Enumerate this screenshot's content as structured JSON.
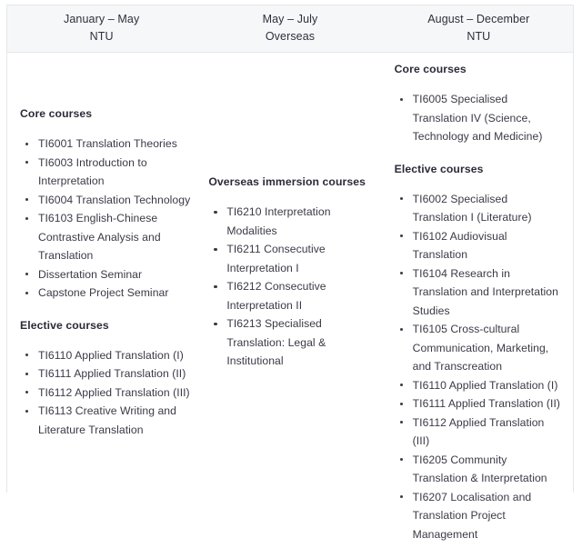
{
  "table": {
    "headers": [
      {
        "period": "January – May",
        "location": "NTU"
      },
      {
        "period": "May – July",
        "location": "Overseas"
      },
      {
        "period": "August – December",
        "location": "NTU"
      }
    ],
    "columns": [
      {
        "name": "january-may-ntu",
        "sections": [
          {
            "heading": "Core courses",
            "courses": [
              "TI6001 Translation Theories",
              "TI6003 Introduction to Interpretation",
              "TI6004 Translation Technology",
              "TI6103 English-Chinese Contrastive Analysis and Translation",
              "Dissertation Seminar",
              "Capstone Project Seminar"
            ]
          },
          {
            "heading": "Elective courses",
            "courses": [
              "TI6110 Applied Translation (I)",
              "TI6111 Applied Translation (II)",
              "TI6112 Applied Translation (III)",
              "TI6113 Creative Writing and Literature Translation"
            ]
          }
        ]
      },
      {
        "name": "may-july-overseas",
        "sections": [
          {
            "heading": "Overseas immersion courses",
            "courses": [
              "TI6210 Interpretation Modalities",
              "TI6211 Consecutive Interpretation I",
              "TI6212 Consecutive Interpretation II",
              "TI6213 Specialised Translation: Legal & Institutional"
            ]
          }
        ]
      },
      {
        "name": "august-december-ntu",
        "sections": [
          {
            "heading": "Core courses",
            "courses": [
              "TI6005 Specialised Translation IV (Science, Technology and Medicine)"
            ]
          },
          {
            "heading": "Elective courses",
            "courses": [
              "TI6002 Specialised Translation I (Literature)",
              "TI6102 Audiovisual Translation",
              "TI6104 Research in Translation and Interpretation Studies",
              "TI6105 Cross-cultural Communication, Marketing, and Transcreation",
              "TI6110 Applied Translation (I)",
              "TI6111 Applied Translation (II)",
              "TI6112 Applied Translation (III)",
              "TI6205 Community Translation & Interpretation",
              "TI6207 Localisation and Translation Project Management"
            ]
          }
        ]
      }
    ]
  },
  "colors": {
    "header_background": "#f6f7f9",
    "border": "#e6e7ea",
    "text": "#33333f",
    "heading_text": "#2b2b38",
    "page_background": "#ffffff"
  }
}
